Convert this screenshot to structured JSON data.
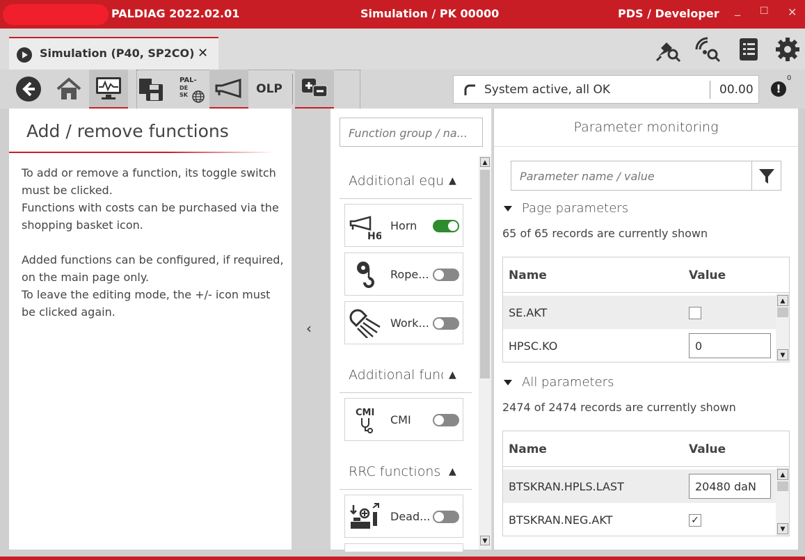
{
  "window": {
    "app_title": "PALDIAG 2022.02.01",
    "center_title": "Simulation / PK 00000",
    "user": "PDS / Developer",
    "minimize": "_",
    "maximize": "☐",
    "close": "✕"
  },
  "tab": {
    "label": "Simulation (P40, SP2CO)",
    "close": "✕"
  },
  "toolbar": {
    "pal_label": "PAL-",
    "de_label": "DE",
    "sk_label": "SK",
    "olp_label": "OLP",
    "status_text": "System active, all OK",
    "status_value": "00.00",
    "alert_count": "0"
  },
  "left": {
    "title": "Add / remove functions",
    "paragraph1": "To add or remove a function, its toggle switch must be clicked.\nFunctions with costs can be purchased via the shopping basket icon.",
    "paragraph2": "Added functions can be configured, if required, on the main page only.\nTo leave the editing mode, the +/- icon must be clicked again."
  },
  "middle": {
    "search_placeholder": "Function group / na...",
    "groups": [
      {
        "label": "Additional equi"
      },
      {
        "label": "Additional func"
      },
      {
        "label": "RRC functions"
      }
    ],
    "functions": [
      {
        "label": "Horn",
        "on": true,
        "icon_label": "H6"
      },
      {
        "label": "Rope...",
        "on": false
      },
      {
        "label": "Work...",
        "on": false
      },
      {
        "label": "CMI",
        "on": false,
        "icon_label": "CMI"
      },
      {
        "label": "Dead...",
        "on": false
      }
    ]
  },
  "right": {
    "title": "Parameter monitoring",
    "search_placeholder": "Parameter name / value",
    "page_section": "Page parameters",
    "page_count": "65 of 65 records are currently shown",
    "all_section": "All parameters",
    "all_count": "2474 of 2474 records are currently shown",
    "col_name": "Name",
    "col_value": "Value",
    "page_rows": [
      {
        "name": "SE.AKT",
        "type": "checkbox",
        "checked": false
      },
      {
        "name": "HPSC.KO",
        "type": "text",
        "value": "0"
      }
    ],
    "all_rows": [
      {
        "name": "BTSKRAN.HPLS.LAST",
        "type": "text",
        "value": "20480 daN"
      },
      {
        "name": "BTSKRAN.NEG.AKT",
        "type": "checkbox",
        "checked": true,
        "mark": "✓"
      }
    ]
  }
}
